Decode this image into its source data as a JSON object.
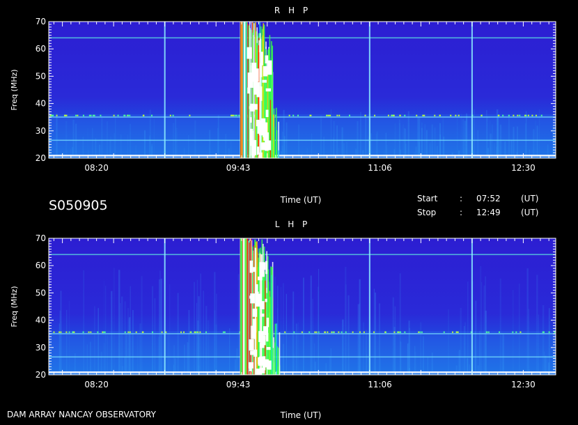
{
  "observation_id": "S050905",
  "footer_left": "DAM ARRAY  NANCAY OBSERVATORY",
  "time_info": {
    "start_label": "Start",
    "start_sep": ":",
    "start_value": "07:52",
    "start_unit": "(UT)",
    "stop_label": "Stop",
    "stop_sep": ":",
    "stop_value": "12:49",
    "stop_unit": "(UT)"
  },
  "colors": {
    "background": "#000000",
    "base": "#2a1fd0",
    "grid": "#8ef0ff",
    "burst_core": "#ffffff",
    "burst_edge": "#ff2a00"
  },
  "chart_data": [
    {
      "type": "heatmap",
      "title": "R H P",
      "xlabel": "Time (UT)",
      "ylabel": "Freq (MHz)",
      "x_ticks": [
        "08:20",
        "09:43",
        "11:06",
        "12:30"
      ],
      "y_ticks": [
        "20",
        "30",
        "40",
        "50",
        "60",
        "70"
      ],
      "xlim": [
        "07:52",
        "12:49"
      ],
      "ylim": [
        20,
        70
      ],
      "bursts": [
        {
          "time_start": "09:44",
          "time_end": "09:48",
          "freq_low": 20,
          "freq_high": 70,
          "intensity": 1.0
        },
        {
          "time_start": "09:48",
          "time_end": "10:03",
          "freq_low": 20,
          "freq_high": 70,
          "intensity": 0.85
        },
        {
          "time_start": "10:03",
          "time_end": "10:07",
          "freq_low": 20,
          "freq_high": 40,
          "intensity": 0.5
        }
      ],
      "interference_lines_mhz": [
        35,
        26.5,
        21,
        64
      ]
    },
    {
      "type": "heatmap",
      "title": "L H P",
      "xlabel": "Time (UT)",
      "ylabel": "Freq (MHz)",
      "x_ticks": [
        "08:20",
        "09:43",
        "11:06",
        "12:30"
      ],
      "y_ticks": [
        "20",
        "30",
        "40",
        "50",
        "60",
        "70"
      ],
      "xlim": [
        "07:52",
        "12:49"
      ],
      "ylim": [
        20,
        70
      ],
      "bursts": [
        {
          "time_start": "09:44",
          "time_end": "09:48",
          "freq_low": 20,
          "freq_high": 70,
          "intensity": 1.0
        },
        {
          "time_start": "09:48",
          "time_end": "10:03",
          "freq_low": 20,
          "freq_high": 70,
          "intensity": 0.9
        },
        {
          "time_start": "10:03",
          "time_end": "10:07",
          "freq_low": 20,
          "freq_high": 40,
          "intensity": 0.55
        }
      ],
      "interference_lines_mhz": [
        35,
        26.5,
        21,
        64
      ]
    }
  ]
}
